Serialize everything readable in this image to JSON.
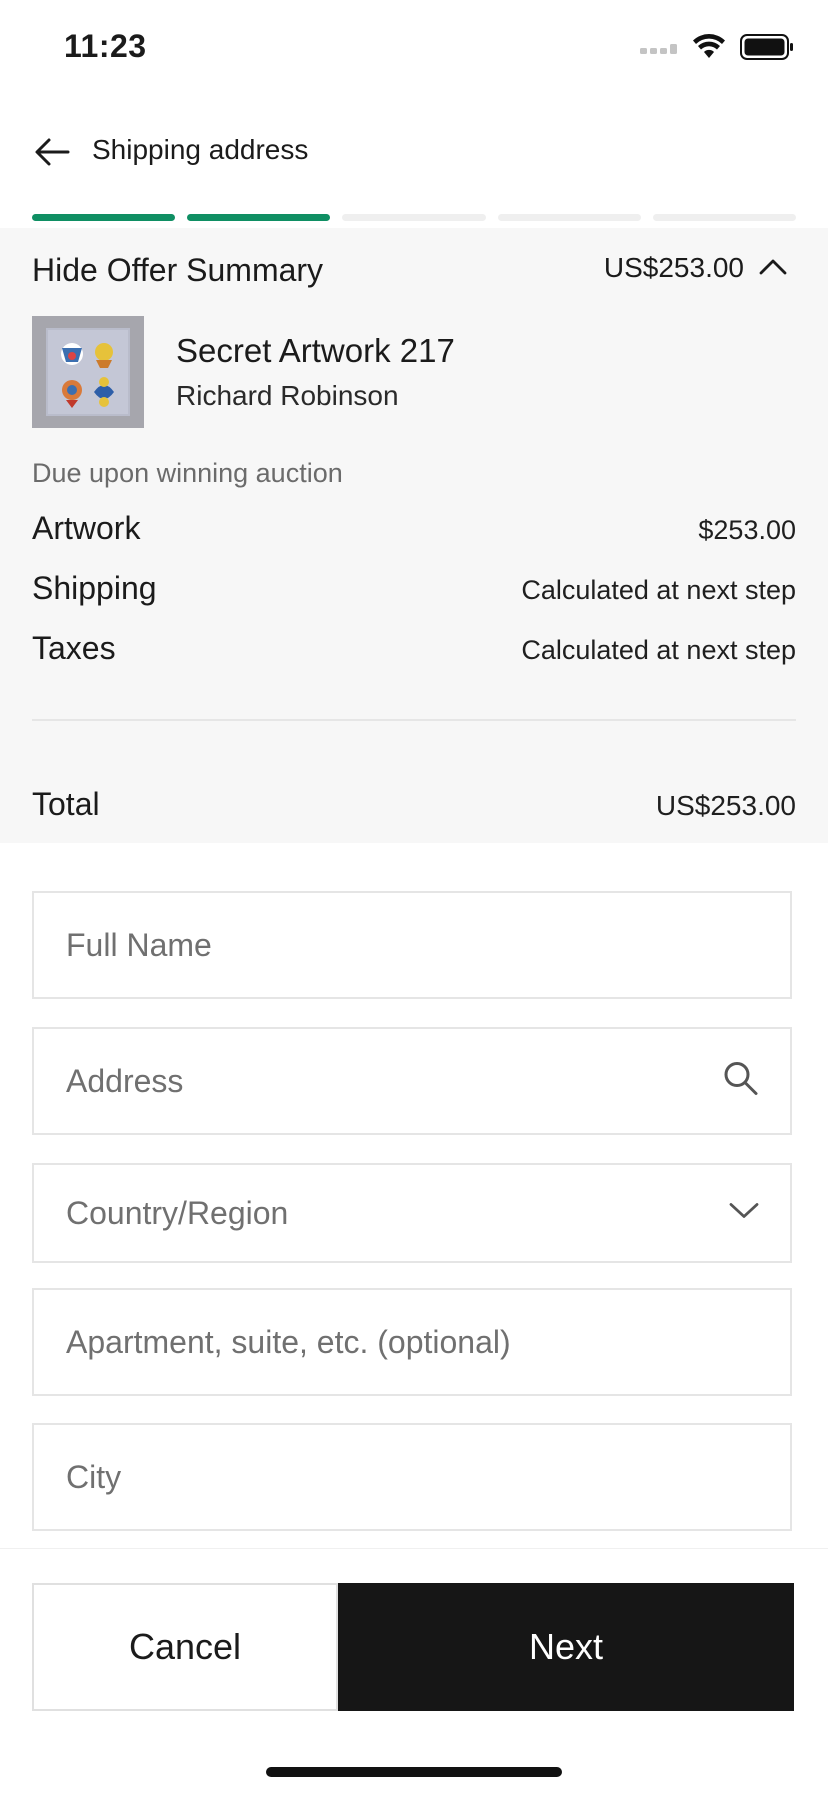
{
  "status_bar": {
    "time": "11:23"
  },
  "nav": {
    "title": "Shipping address"
  },
  "progress": {
    "total_steps": 5,
    "completed_steps": 2
  },
  "summary": {
    "toggle_label": "Hide Offer Summary",
    "header_total": "US$253.00",
    "artwork_title": "Secret Artwork 217",
    "artist": "Richard Robinson",
    "due_note": "Due upon winning auction",
    "lines": [
      {
        "label": "Artwork",
        "value": "$253.00"
      },
      {
        "label": "Shipping",
        "value": "Calculated at next step"
      },
      {
        "label": "Taxes",
        "value": "Calculated at next step"
      }
    ],
    "total_label": "Total",
    "total_value": "US$253.00"
  },
  "form": {
    "full_name_placeholder": "Full Name",
    "address_placeholder": "Address",
    "country_placeholder": "Country/Region",
    "apartment_placeholder": "Apartment, suite, etc. (optional)",
    "city_placeholder": "City"
  },
  "footer": {
    "cancel_label": "Cancel",
    "next_label": "Next"
  },
  "colors": {
    "progress_active": "#0f8f63",
    "next_button": "#161616"
  }
}
